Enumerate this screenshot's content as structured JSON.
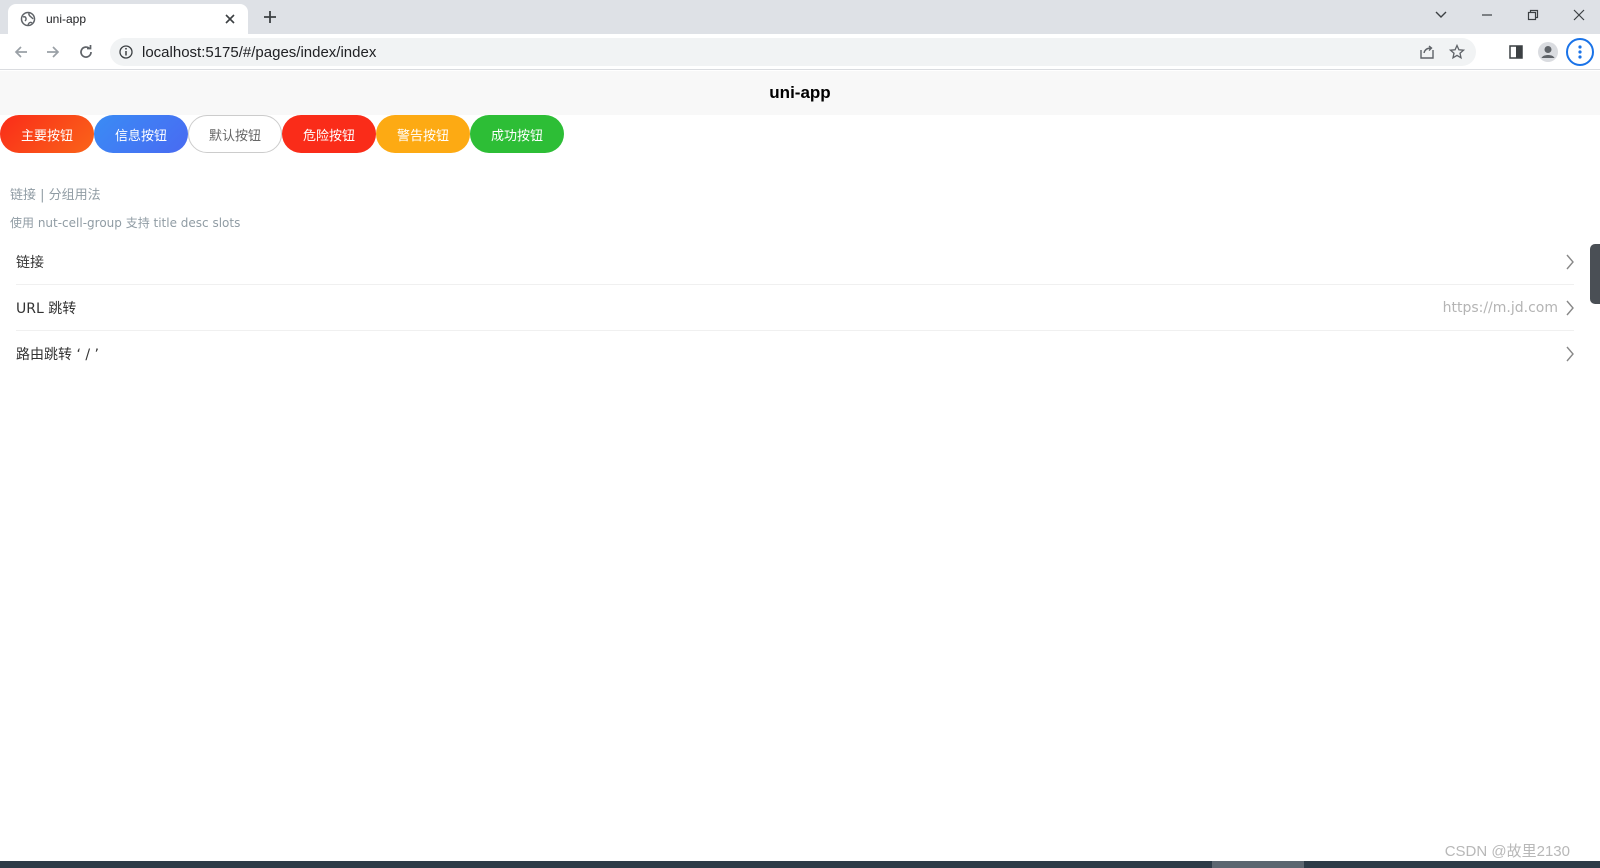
{
  "browser": {
    "tab_title": "uni-app",
    "url": "localhost:5175/#/pages/index/index"
  },
  "page": {
    "header_title": "uni-app",
    "buttons": [
      {
        "label": "主要按钮",
        "color": "#fa3c1f"
      },
      {
        "label": "信息按钮",
        "color": "#4e7ef2"
      },
      {
        "label": "默认按钮",
        "color": "#ffffff"
      },
      {
        "label": "危险按钮",
        "color": "#fa2c19"
      },
      {
        "label": "警告按钮",
        "color": "#fda80f"
      },
      {
        "label": "成功按钮",
        "color": "#2dbe36"
      }
    ],
    "section_title": "链接 | 分组用法",
    "section_desc": "使用 nut-cell-group 支持 title desc slots",
    "cells": [
      {
        "title": "链接",
        "desc": ""
      },
      {
        "title": "URL 跳转",
        "desc": "https://m.jd.com"
      },
      {
        "title": "路由跳转 ‘ / ’",
        "desc": ""
      }
    ]
  },
  "watermark": "CSDN @故里2130"
}
